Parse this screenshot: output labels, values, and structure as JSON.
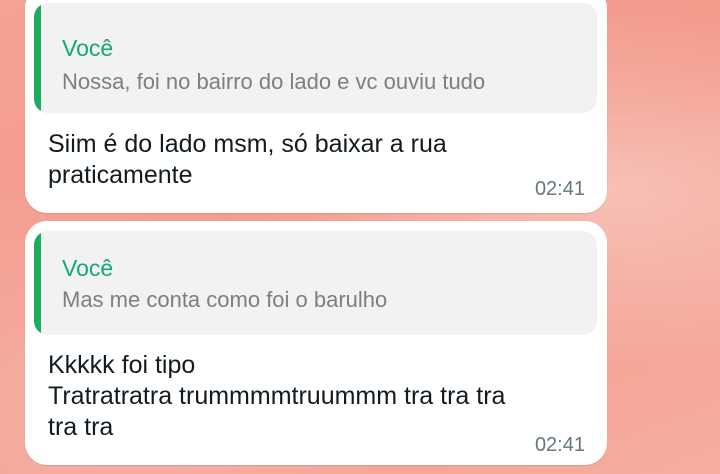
{
  "messages": [
    {
      "quote": {
        "author": "Você",
        "text": "Nossa, foi no bairro do lado e vc ouviu tudo"
      },
      "text": "Siim é do lado msm, só baixar a rua\npraticamente",
      "time": "02:41"
    },
    {
      "quote": {
        "author": "Você",
        "text": "Mas me conta como foi o barulho"
      },
      "text": "Kkkkk foi tipo\nTratratratra trummmmtruummm tra tra tra\ntra tra",
      "time": "02:41"
    }
  ],
  "colors": {
    "wallpaper": "#f4a293",
    "quote_accent": "#1daa61",
    "quote_author": "#16a77a",
    "bubble": "#ffffff"
  }
}
